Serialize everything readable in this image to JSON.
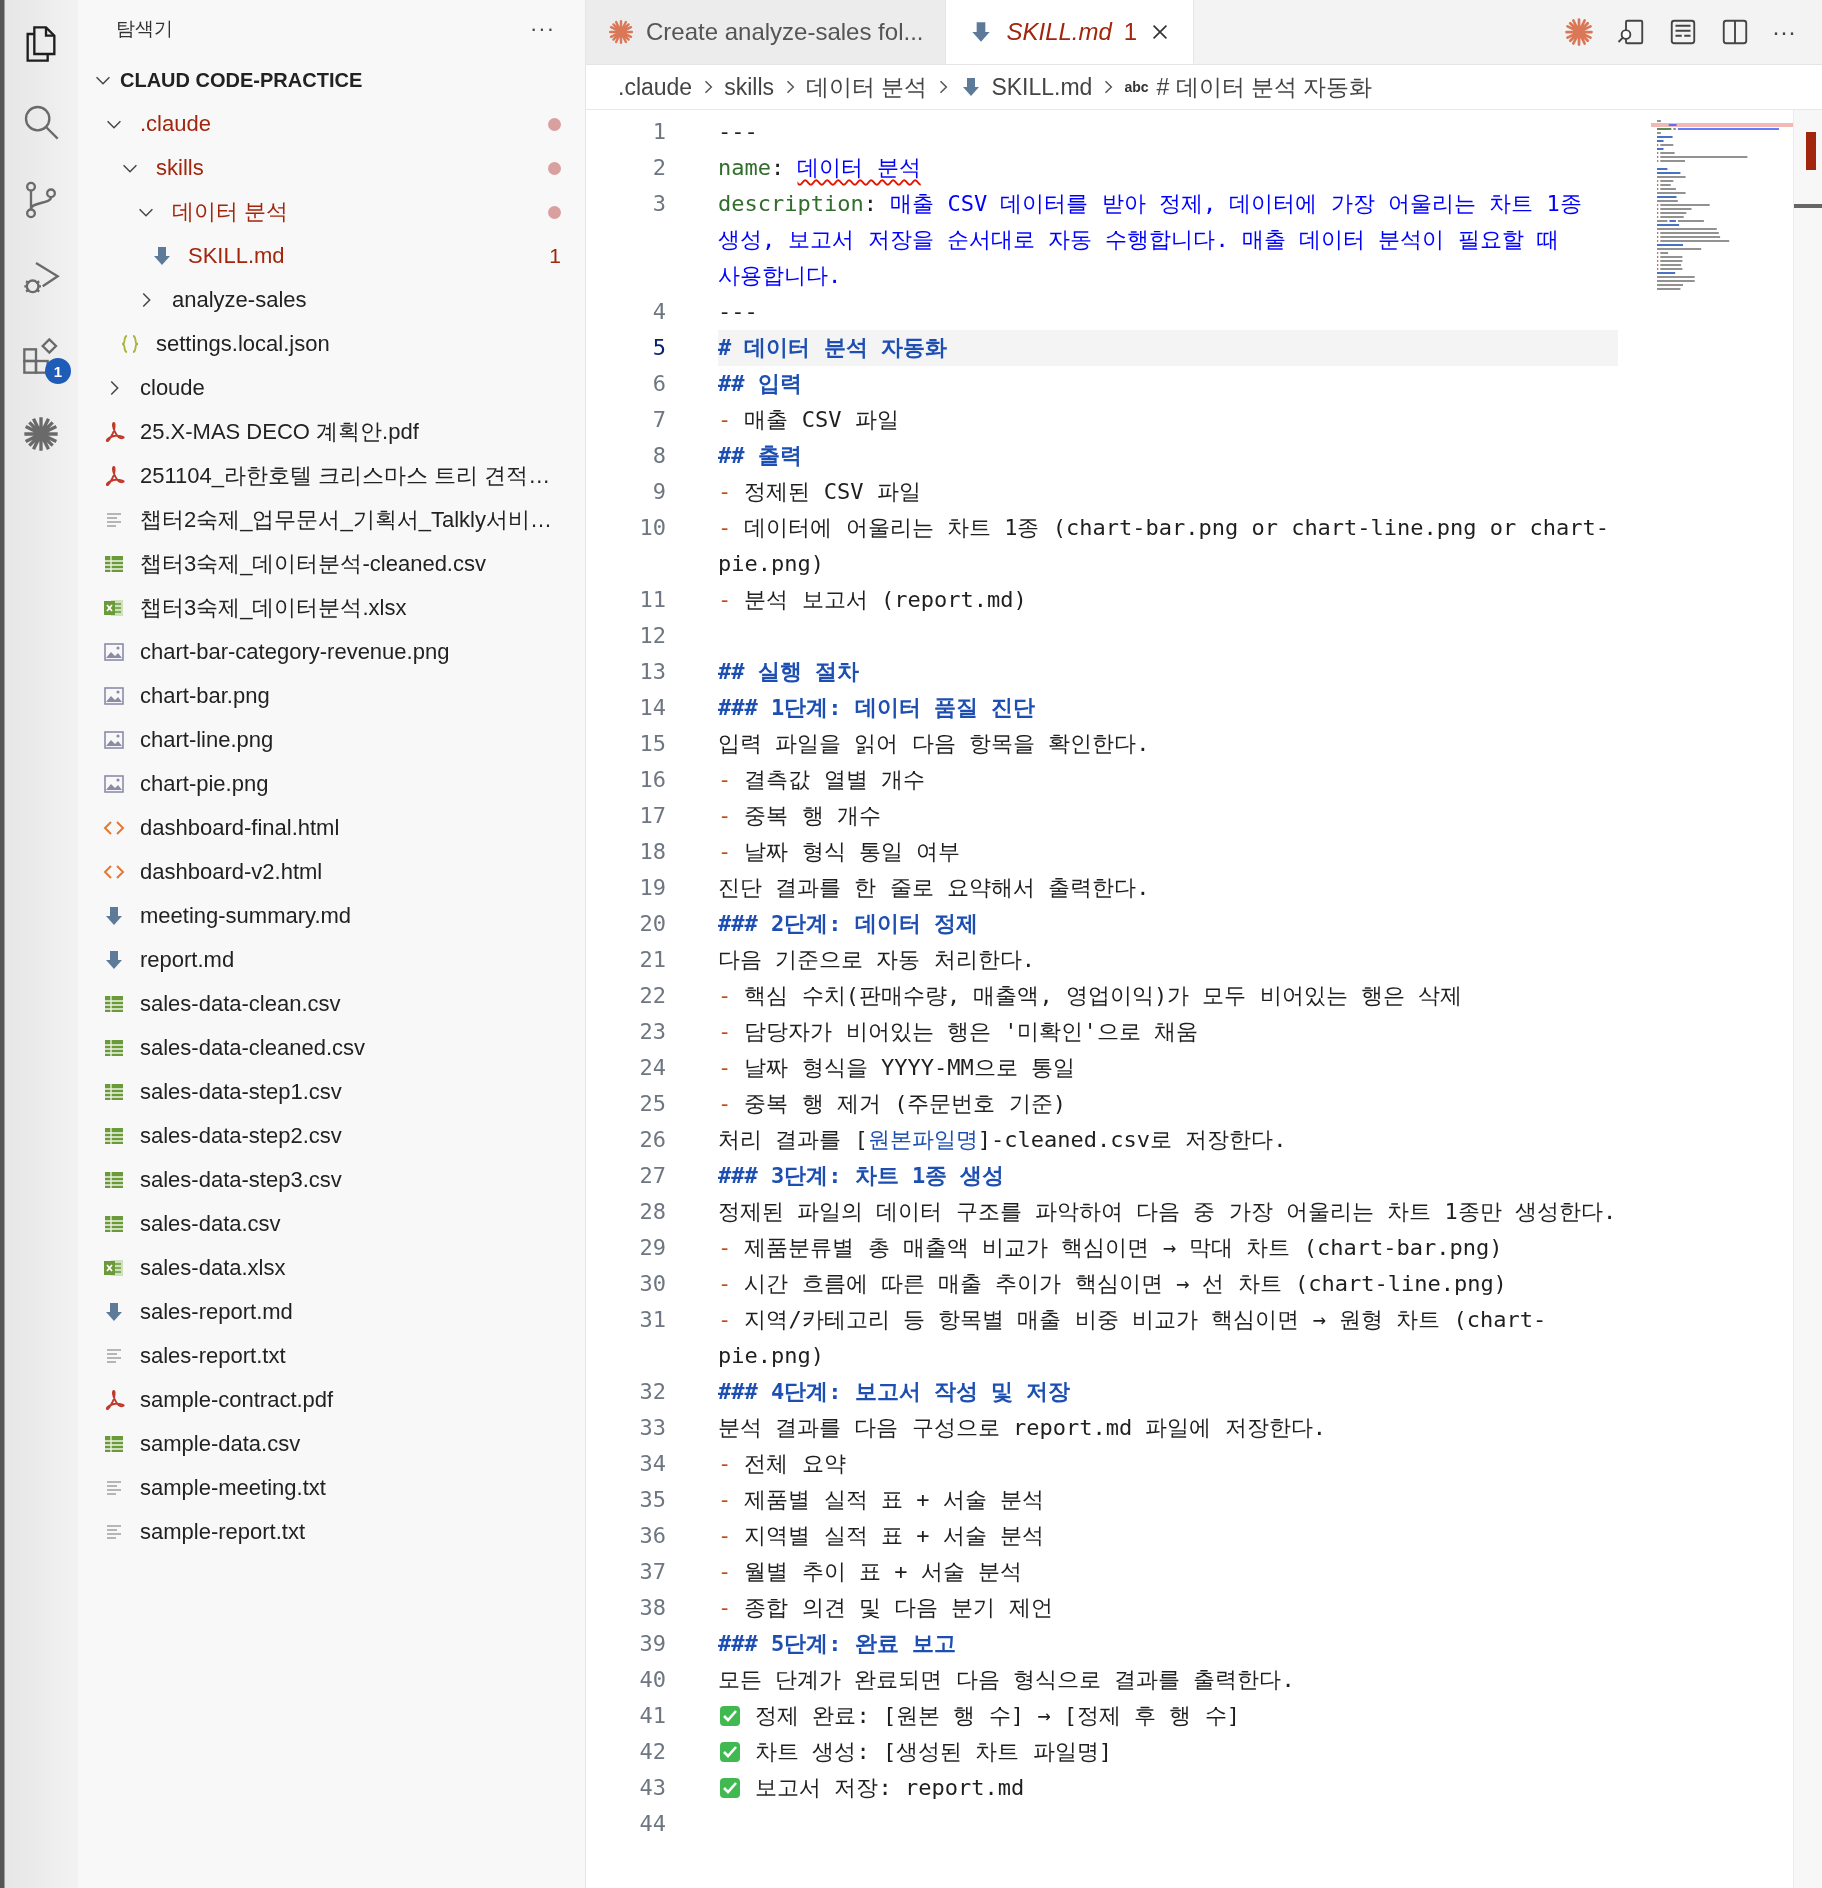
{
  "activity_bar": {
    "items": [
      {
        "kind": "files",
        "selected": true
      },
      {
        "kind": "search",
        "selected": false
      },
      {
        "kind": "source-control",
        "selected": false
      },
      {
        "kind": "run-debug",
        "selected": false
      },
      {
        "kind": "extensions",
        "selected": false,
        "badge": "1"
      },
      {
        "kind": "burst",
        "selected": false
      }
    ]
  },
  "sidebar": {
    "title": "탐색기",
    "more": "···",
    "section": {
      "label": "CLAUD CODE-PRACTICE",
      "expanded": true
    },
    "tree": [
      {
        "label": ".claude",
        "kind": "folder",
        "expanded": true,
        "error": true,
        "dot": true,
        "children": [
          {
            "label": "skills",
            "kind": "folder",
            "expanded": true,
            "error": true,
            "dot": true,
            "children": [
              {
                "label": "데이터 분석",
                "kind": "folder",
                "expanded": true,
                "error": true,
                "dot": true,
                "children": [
                  {
                    "label": "SKILL.md",
                    "kind": "md",
                    "error": true,
                    "dot": false,
                    "problems": "1"
                  }
                ]
              },
              {
                "label": "analyze-sales",
                "kind": "folder",
                "expanded": false,
                "error": false,
                "dot": false
              }
            ]
          },
          {
            "label": "settings.local.json",
            "kind": "json",
            "error": false,
            "dot": false
          }
        ]
      },
      {
        "label": "cloude",
        "kind": "folder",
        "expanded": false,
        "error": false,
        "dot": false
      },
      {
        "label": "25.X-MAS DECO 계획안.pdf",
        "kind": "pdf",
        "error": false,
        "dot": false
      },
      {
        "label": "251104_라한호텔 크리스마스 트리 견적…",
        "kind": "pdf",
        "error": false,
        "dot": false
      },
      {
        "label": "챕터2숙제_업무문서_기획서_Talkly서비…",
        "kind": "txt",
        "error": false,
        "dot": false
      },
      {
        "label": "챕터3숙제_데이터분석-cleaned.csv",
        "kind": "csv",
        "error": false,
        "dot": false
      },
      {
        "label": "챕터3숙제_데이터분석.xlsx",
        "kind": "xlsx",
        "error": false,
        "dot": false
      },
      {
        "label": "chart-bar-category-revenue.png",
        "kind": "png",
        "error": false,
        "dot": false
      },
      {
        "label": "chart-bar.png",
        "kind": "png",
        "error": false,
        "dot": false
      },
      {
        "label": "chart-line.png",
        "kind": "png",
        "error": false,
        "dot": false
      },
      {
        "label": "chart-pie.png",
        "kind": "png",
        "error": false,
        "dot": false
      },
      {
        "label": "dashboard-final.html",
        "kind": "html",
        "error": false,
        "dot": false
      },
      {
        "label": "dashboard-v2.html",
        "kind": "html",
        "error": false,
        "dot": false
      },
      {
        "label": "meeting-summary.md",
        "kind": "md",
        "error": false,
        "dot": false
      },
      {
        "label": "report.md",
        "kind": "md",
        "error": false,
        "dot": false
      },
      {
        "label": "sales-data-clean.csv",
        "kind": "csv",
        "error": false,
        "dot": false
      },
      {
        "label": "sales-data-cleaned.csv",
        "kind": "csv",
        "error": false,
        "dot": false
      },
      {
        "label": "sales-data-step1.csv",
        "kind": "csv",
        "error": false,
        "dot": false
      },
      {
        "label": "sales-data-step2.csv",
        "kind": "csv",
        "error": false,
        "dot": false
      },
      {
        "label": "sales-data-step3.csv",
        "kind": "csv",
        "error": false,
        "dot": false
      },
      {
        "label": "sales-data.csv",
        "kind": "csv",
        "error": false,
        "dot": false
      },
      {
        "label": "sales-data.xlsx",
        "kind": "xlsx",
        "error": false,
        "dot": false
      },
      {
        "label": "sales-report.md",
        "kind": "md",
        "error": false,
        "dot": false
      },
      {
        "label": "sales-report.txt",
        "kind": "txt",
        "error": false,
        "dot": false
      },
      {
        "label": "sample-contract.pdf",
        "kind": "pdf",
        "error": false,
        "dot": false
      },
      {
        "label": "sample-data.csv",
        "kind": "csv",
        "error": false,
        "dot": false
      },
      {
        "label": "sample-meeting.txt",
        "kind": "txt",
        "error": false,
        "dot": false
      },
      {
        "label": "sample-report.txt",
        "kind": "txt",
        "error": false,
        "dot": false
      }
    ]
  },
  "editor": {
    "tabs": [
      {
        "label": "Create analyze-sales fol...",
        "kind": "agent",
        "selected": false,
        "preview": false,
        "error": false
      },
      {
        "label": "SKILL.md",
        "kind": "md",
        "selected": true,
        "preview": true,
        "error": true,
        "problems": "1"
      }
    ],
    "actions": [
      {
        "kind": "burst"
      },
      {
        "kind": "preview"
      },
      {
        "kind": "layout"
      },
      {
        "kind": "split"
      },
      {
        "kind": "more",
        "text": "···"
      }
    ],
    "breadcrumbs": [
      {
        "label": ".claude",
        "kind": "folder"
      },
      {
        "label": "skills",
        "kind": "folder"
      },
      {
        "label": "데이터 분석",
        "kind": "folder"
      },
      {
        "label": "SKILL.md",
        "kind": "md"
      },
      {
        "label": "# 데이터 분석 자동화",
        "kind": "symbol",
        "symbol": "abc"
      }
    ],
    "lines": [
      {
        "number": "1",
        "segments": [
          {
            "kind": "plain",
            "text": "---"
          }
        ]
      },
      {
        "number": "2",
        "segments": [
          {
            "kind": "key",
            "text": "name"
          },
          {
            "kind": "plain",
            "text": ": "
          },
          {
            "kind": "value",
            "text": "데이터 분석",
            "squiggle": true
          }
        ]
      },
      {
        "number": "3",
        "segments": [
          {
            "kind": "key",
            "text": "description"
          },
          {
            "kind": "plain",
            "text": ": "
          },
          {
            "kind": "value",
            "text": "매출 CSV 데이터를 받아 정제, 데이터에 가장 어울리는 차트 1종 생성, 보고서 저장을 순서대로 자동 수행합니다. 매출 데이터 분석이 필요할 때 사용합니다."
          }
        ]
      },
      {
        "number": "4",
        "segments": [
          {
            "kind": "plain",
            "text": "---"
          }
        ]
      },
      {
        "number": "5",
        "current": true,
        "segments": [
          {
            "kind": "heading",
            "text": "# 데이터 분석 자동화"
          }
        ]
      },
      {
        "number": "6",
        "segments": [
          {
            "kind": "heading",
            "text": "## 입력"
          }
        ]
      },
      {
        "number": "7",
        "segments": [
          {
            "kind": "dash",
            "text": "-"
          },
          {
            "kind": "plain",
            "text": " 매출 CSV 파일"
          }
        ]
      },
      {
        "number": "8",
        "segments": [
          {
            "kind": "heading",
            "text": "## 출력"
          }
        ]
      },
      {
        "number": "9",
        "segments": [
          {
            "kind": "dash",
            "text": "-"
          },
          {
            "kind": "plain",
            "text": " 정제된 CSV 파일"
          }
        ]
      },
      {
        "number": "10",
        "segments": [
          {
            "kind": "dash",
            "text": "-"
          },
          {
            "kind": "plain",
            "text": " 데이터에 어울리는 차트 1종 (chart-bar.png or chart-line.png or chart-pie.png)"
          }
        ]
      },
      {
        "number": "11",
        "segments": [
          {
            "kind": "dash",
            "text": "-"
          },
          {
            "kind": "plain",
            "text": " 분석 보고서 (report.md)"
          }
        ]
      },
      {
        "number": "12"
      },
      {
        "number": "13",
        "segments": [
          {
            "kind": "heading",
            "text": "## 실행 절차"
          }
        ]
      },
      {
        "number": "14",
        "segments": [
          {
            "kind": "heading",
            "text": "### 1단계: 데이터 품질 진단"
          }
        ]
      },
      {
        "number": "15",
        "segments": [
          {
            "kind": "plain",
            "text": "입력 파일을 읽어 다음 항목을 확인한다."
          }
        ]
      },
      {
        "number": "16",
        "segments": [
          {
            "kind": "dash",
            "text": "-"
          },
          {
            "kind": "plain",
            "text": " 결측값 열별 개수"
          }
        ]
      },
      {
        "number": "17",
        "segments": [
          {
            "kind": "dash",
            "text": "-"
          },
          {
            "kind": "plain",
            "text": " 중복 행 개수"
          }
        ]
      },
      {
        "number": "18",
        "segments": [
          {
            "kind": "dash",
            "text": "-"
          },
          {
            "kind": "plain",
            "text": " 날짜 형식 통일 여부"
          }
        ]
      },
      {
        "number": "19",
        "segments": [
          {
            "kind": "plain",
            "text": "진단 결과를 한 줄로 요약해서 출력한다."
          }
        ]
      },
      {
        "number": "20",
        "segments": [
          {
            "kind": "heading",
            "text": "### 2단계: 데이터 정제"
          }
        ]
      },
      {
        "number": "21",
        "segments": [
          {
            "kind": "plain",
            "text": "다음 기준으로 자동 처리한다."
          }
        ]
      },
      {
        "number": "22",
        "segments": [
          {
            "kind": "dash",
            "text": "-"
          },
          {
            "kind": "plain",
            "text": " 핵심 수치(판매수량, 매출액, 영업이익)가 모두 비어있는 행은 삭제"
          }
        ]
      },
      {
        "number": "23",
        "segments": [
          {
            "kind": "dash",
            "text": "-"
          },
          {
            "kind": "plain",
            "text": " 담당자가 비어있는 행은 '미확인'으로 채움"
          }
        ]
      },
      {
        "number": "24",
        "segments": [
          {
            "kind": "dash",
            "text": "-"
          },
          {
            "kind": "plain",
            "text": " 날짜 형식을 YYYY-MM으로 통일"
          }
        ]
      },
      {
        "number": "25",
        "segments": [
          {
            "kind": "dash",
            "text": "-"
          },
          {
            "kind": "plain",
            "text": " 중복 행 제거 (주문번호 기준)"
          }
        ]
      },
      {
        "number": "26",
        "segments": [
          {
            "kind": "plain",
            "text": "처리 결과를 ["
          },
          {
            "kind": "link",
            "text": "원본파일명"
          },
          {
            "kind": "plain",
            "text": "]-cleaned.csv로 저장한다."
          }
        ]
      },
      {
        "number": "27",
        "segments": [
          {
            "kind": "heading",
            "text": "### 3단계: 차트 1종 생성"
          }
        ]
      },
      {
        "number": "28",
        "segments": [
          {
            "kind": "plain",
            "text": "정제된 파일의 데이터 구조를 파악하여 다음 중 가장 어울리는 차트 1종만 생성한다."
          }
        ]
      },
      {
        "number": "29",
        "segments": [
          {
            "kind": "dash",
            "text": "-"
          },
          {
            "kind": "plain",
            "text": " 제품분류별 총 매출액 비교가 핵심이면 → 막대 차트 (chart-bar.png)"
          }
        ]
      },
      {
        "number": "30",
        "segments": [
          {
            "kind": "dash",
            "text": "-"
          },
          {
            "kind": "plain",
            "text": " 시간 흐름에 따른 매출 추이가 핵심이면 → 선 차트 (chart-line.png)"
          }
        ]
      },
      {
        "number": "31",
        "segments": [
          {
            "kind": "dash",
            "text": "-"
          },
          {
            "kind": "plain",
            "text": " 지역/카테고리 등 항목별 매출 비중 비교가 핵심이면 → 원형 차트 (chart-pie.png)"
          }
        ]
      },
      {
        "number": "32",
        "segments": [
          {
            "kind": "heading",
            "text": "### 4단계: 보고서 작성 및 저장"
          }
        ]
      },
      {
        "number": "33",
        "segments": [
          {
            "kind": "plain",
            "text": "분석 결과를 다음 구성으로 report.md 파일에 저장한다."
          }
        ]
      },
      {
        "number": "34",
        "segments": [
          {
            "kind": "dash",
            "text": "-"
          },
          {
            "kind": "plain",
            "text": " 전체 요약"
          }
        ]
      },
      {
        "number": "35",
        "segments": [
          {
            "kind": "dash",
            "text": "-"
          },
          {
            "kind": "plain",
            "text": " 제품별 실적 표 + 서술 분석"
          }
        ]
      },
      {
        "number": "36",
        "segments": [
          {
            "kind": "dash",
            "text": "-"
          },
          {
            "kind": "plain",
            "text": " 지역별 실적 표 + 서술 분석"
          }
        ]
      },
      {
        "number": "37",
        "segments": [
          {
            "kind": "dash",
            "text": "-"
          },
          {
            "kind": "plain",
            "text": " 월별 추이 표 + 서술 분석"
          }
        ]
      },
      {
        "number": "38",
        "segments": [
          {
            "kind": "dash",
            "text": "-"
          },
          {
            "kind": "plain",
            "text": " 종합 의견 및 다음 분기 제언"
          }
        ]
      },
      {
        "number": "39",
        "segments": [
          {
            "kind": "heading",
            "text": "### 5단계: 완료 보고"
          }
        ]
      },
      {
        "number": "40",
        "segments": [
          {
            "kind": "plain",
            "text": "모든 단계가 완료되면 다음 형식으로 결과를 출력한다."
          }
        ]
      },
      {
        "number": "41",
        "segments": [
          {
            "kind": "check"
          },
          {
            "kind": "plain",
            "text": " 정제 완료: [원본 행 수] → [정제 후 행 수]"
          }
        ]
      },
      {
        "number": "42",
        "segments": [
          {
            "kind": "check"
          },
          {
            "kind": "plain",
            "text": " 차트 생성: [생성된 차트 파일명]"
          }
        ]
      },
      {
        "number": "43",
        "segments": [
          {
            "kind": "check"
          },
          {
            "kind": "plain",
            "text": " 보고서 저장: report.md"
          }
        ]
      },
      {
        "number": "44"
      }
    ]
  }
}
